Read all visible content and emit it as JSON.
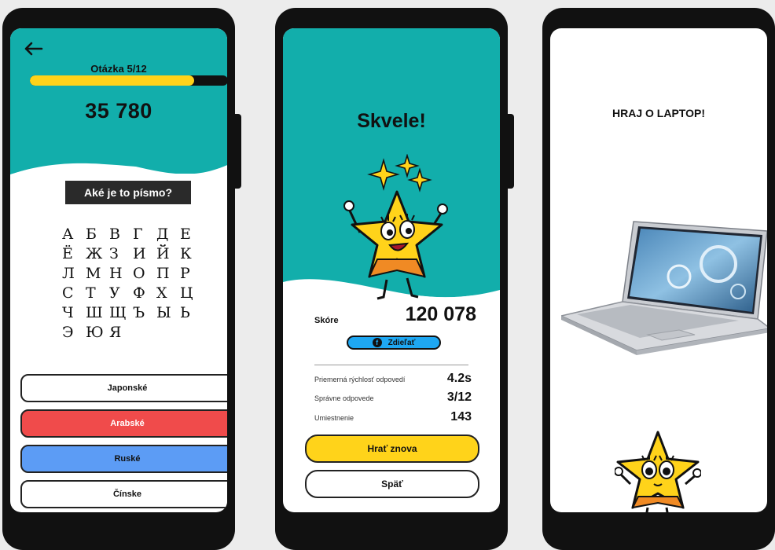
{
  "phone1": {
    "question_label": "Otázka 5/12",
    "progress_fraction": 0.83,
    "score": "35 780",
    "prompt": "Aké je to písmo?",
    "letters": [
      [
        "А",
        "Б",
        "В",
        "Г",
        "Д",
        "Е"
      ],
      [
        "Ё",
        "Ж",
        "З",
        "И",
        "Й",
        "К"
      ],
      [
        "Л",
        "М",
        "Н",
        "О",
        "П",
        "Р"
      ],
      [
        "С",
        "Т",
        "У",
        "Ф",
        "Х",
        "Ц"
      ],
      [
        "Ч",
        "Ш",
        "Щ",
        "Ъ",
        "Ы",
        "Ь"
      ],
      [
        "Э",
        "Ю",
        "Я"
      ]
    ],
    "answers": [
      {
        "label": "Japonské",
        "color": "#ffffff",
        "text_color": "#111111"
      },
      {
        "label": "Arabské",
        "color": "#f04b4b",
        "text_color": "#ffffff"
      },
      {
        "label": "Ruské",
        "color": "#5c9cf5",
        "text_color": "#111111"
      },
      {
        "label": "Čínske",
        "color": "#ffffff",
        "text_color": "#111111"
      }
    ]
  },
  "phone2": {
    "title": "Skvele!",
    "score_label": "Skóre",
    "score_value": "120 078",
    "share_label": "Zdieľať",
    "stats": [
      {
        "label": "Priemerná rýchlosť odpovedí",
        "value": "4.2s"
      },
      {
        "label": "Správne odpovede",
        "value": "3/12"
      },
      {
        "label": "Umiestnenie",
        "value": "143"
      }
    ],
    "play_again": "Hrať znova",
    "back": "Späť"
  },
  "phone3": {
    "title": "HRAJ O LAPTOP!"
  },
  "colors": {
    "teal": "#12aeab",
    "yellow": "#ffd31a",
    "red": "#f04b4b",
    "blue": "#5c9cf5",
    "share_blue": "#1ea7f2",
    "dark": "#111111"
  },
  "icons": [
    "back-arrow-icon",
    "facebook-icon",
    "sparkle-icon",
    "star-mascot",
    "laptop-image"
  ]
}
